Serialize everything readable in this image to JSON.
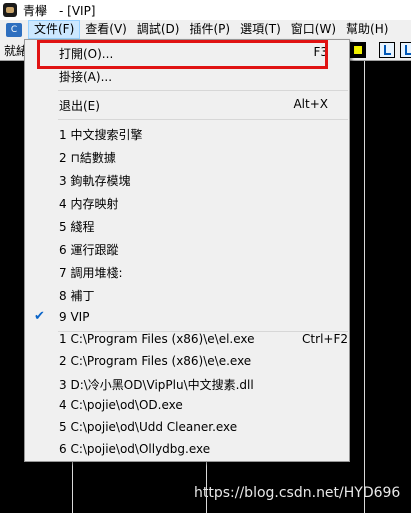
{
  "window": {
    "title": "青欅　- [VIP]"
  },
  "menubar": {
    "items": [
      "文件(F)",
      "查看(V)",
      "調試(D)",
      "插件(P)",
      "選項(T)",
      "窗口(W)",
      "幫助(H)"
    ]
  },
  "toolbar": {
    "status_text": "就緒"
  },
  "dropdown": {
    "open_label": "打開(O)...",
    "open_shortcut": "F3",
    "attach_label": "掛接(A)...",
    "exit_label": "退出(E)",
    "exit_shortcut": "Alt+X",
    "plugin_items": [
      "1 中文搜索引擎",
      "2 ⊓結數據",
      "3 鉤軌存模塊",
      "4 内存映射",
      "5 綫程",
      "6 運行跟蹤",
      "7 調用堆棧:",
      "8 補丁",
      "9 VIP"
    ],
    "checked_item": "9 VIP",
    "recent_files": [
      "1 C:\\Program Files (x86)\\e\\el.exe",
      "2 C:\\Program Files (x86)\\e\\e.exe",
      "3 D:\\冷小黑OD\\VipPlu\\中文搜素.dll",
      "4 C:\\pojie\\od\\OD.exe",
      "5 C:\\pojie\\od\\Udd Cleaner.exe",
      "6 C:\\pojie\\od\\Ollydbg.exe"
    ],
    "recent_first_shortcut": "Ctrl+F2"
  },
  "watermark": "https://blog.csdn.net/HYD696",
  "colors": {
    "highlight": "#e01313",
    "check": "#0a64c8",
    "menu_bg": "#f0f0f0"
  },
  "icons": {
    "app": "app-icon",
    "system_menu": "system-menu-icon",
    "check": "checkmark-icon"
  }
}
